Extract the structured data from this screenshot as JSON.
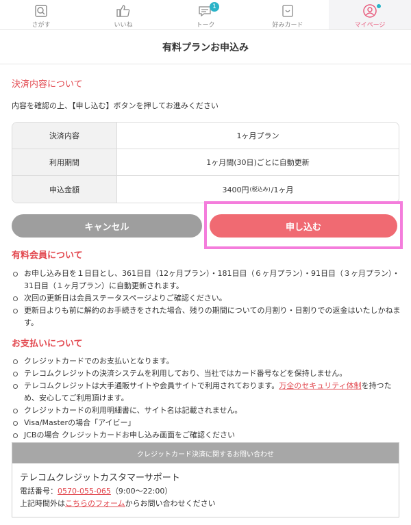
{
  "tabs": [
    {
      "label": "さがす",
      "icon": "search-icon"
    },
    {
      "label": "いいね",
      "icon": "thumbs-up-icon"
    },
    {
      "label": "トーク",
      "icon": "chat-icon",
      "badge": "1"
    },
    {
      "label": "好みカード",
      "icon": "card-icon"
    },
    {
      "label": "マイページ",
      "icon": "user-icon"
    }
  ],
  "title": "有料プランお申込み",
  "payment": {
    "heading": "決済内容について",
    "lead": "内容を確認の上、【申し込む】ボタンを押してお進みください",
    "rows": [
      {
        "key": "決済内容",
        "value": "1ヶ月プラン"
      },
      {
        "key": "利用期間",
        "value": "1ヶ月間(30日)ごとに自動更新"
      },
      {
        "key": "申込金額",
        "value_price": "3400円",
        "value_tax": "(税込み)",
        "value_suffix": "/1ヶ月"
      }
    ]
  },
  "buttons": {
    "cancel": "キャンセル",
    "apply": "申し込む"
  },
  "membership": {
    "heading": "有料会員について",
    "items": [
      "お申し込み日を１日目とし、361日目（12ヶ月プラン）・181日目（６ヶ月プラン）・91日目（３ヶ月プラン）・31日目（１ヶ月プラン）に自動更新されます。",
      "次回の更新日は会員ステータスページよりご確認ください。",
      "更新日よりも前に解約のお手続きをされた場合、残りの期間についての月割り・日割りでの返金はいたしかねます。"
    ]
  },
  "pay": {
    "heading": "お支払いについて",
    "items": [
      "クレジットカードでのお支払いとなります。",
      "テレコムクレジットの決済システムを利用しており、当社ではカード番号などを保持しません。"
    ],
    "item3_pre": "テレコムクレジットは大手通販サイトや会員サイトで利用されております。",
    "item3_link": "万全のセキュリティ体制",
    "item3_post": "を持つため、安心してご利用頂けます。",
    "items_after": [
      "クレジットカードの利用明細書に、サイト名は記載されません。",
      "Visa/Masterの場合「アイビー」",
      "JCBの場合 クレジットカードお申し込み画面をご確認ください"
    ]
  },
  "contact": {
    "header": "クレジットカード決済に関するお問い合わせ",
    "name": "テレコムクレジットカスタマーサポート",
    "tel_label": "電話番号：",
    "tel": "0570-055-065",
    "hours": "（9:00〜22:00）",
    "form_pre": "上記時間外は",
    "form_link": "こちらのフォーム",
    "form_post": "からお問い合わせください"
  }
}
